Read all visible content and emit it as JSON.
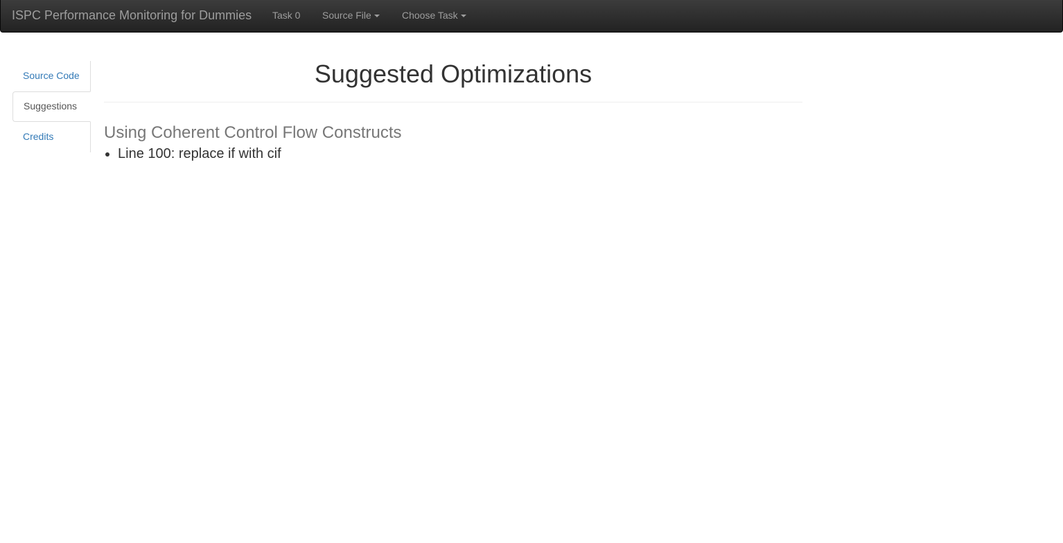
{
  "navbar": {
    "brand": "ISPC Performance Monitoring for Dummies",
    "items": [
      {
        "label": "Task 0",
        "dropdown": false
      },
      {
        "label": "Source File",
        "dropdown": true
      },
      {
        "label": "Choose Task",
        "dropdown": true
      }
    ]
  },
  "sidebar": {
    "items": [
      {
        "label": "Source Code",
        "active": false
      },
      {
        "label": "Suggestions",
        "active": true
      },
      {
        "label": "Credits",
        "active": false
      }
    ]
  },
  "main": {
    "title": "Suggested Optimizations",
    "sections": [
      {
        "title": "Using Coherent Control Flow Constructs",
        "items": [
          "Line 100: replace if with cif"
        ]
      }
    ]
  },
  "colors": {
    "navbar_bg": "#222222",
    "nav_text": "#9d9d9d",
    "link": "#337ab7",
    "active_text": "#555555",
    "heading": "#333333",
    "subheading": "#777777"
  }
}
